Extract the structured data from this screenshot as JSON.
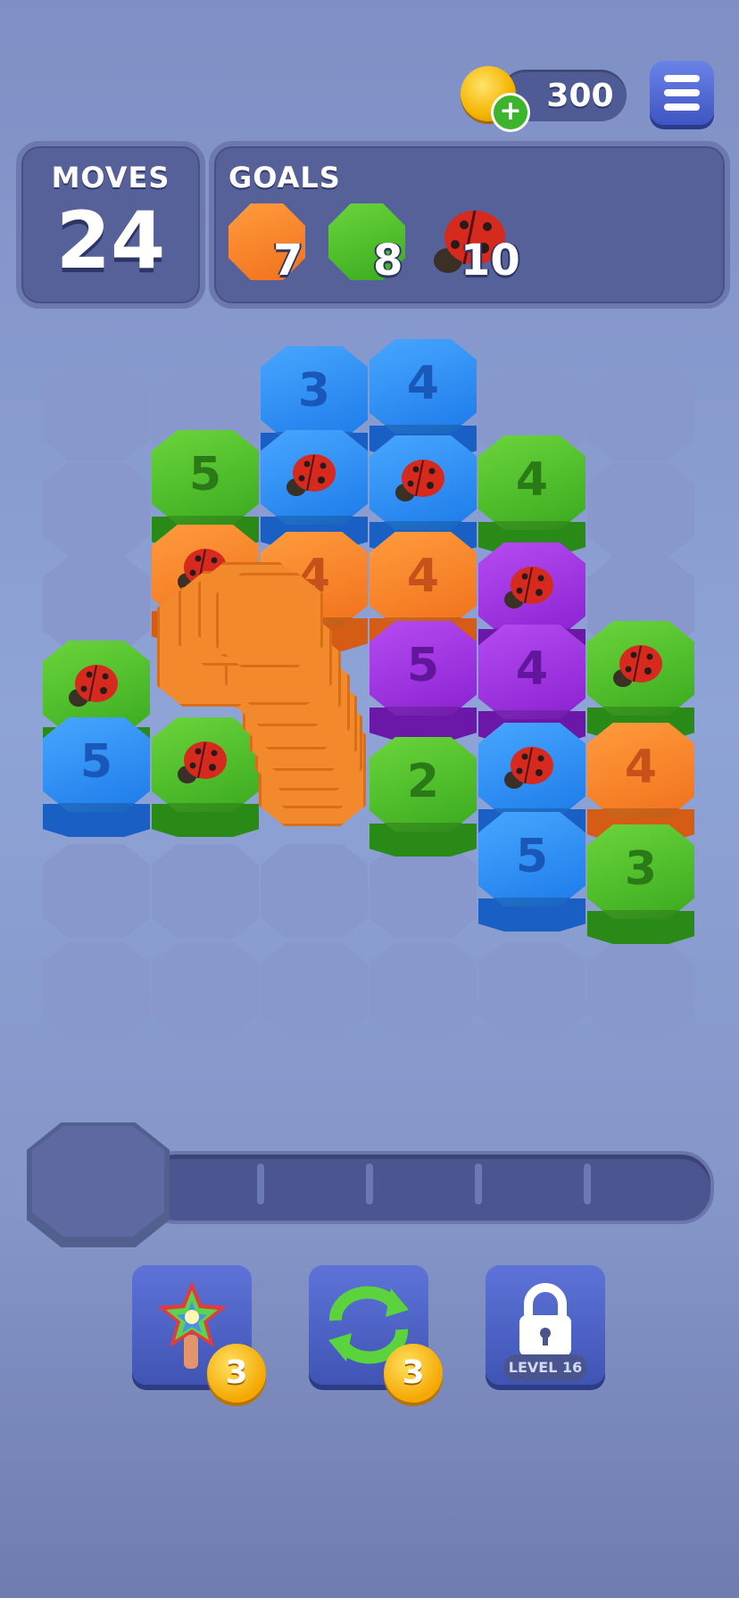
{
  "header": {
    "coins": "300",
    "coin_icon": "gold-coin-icon",
    "plus_icon": "plus-icon",
    "menu_icon": "hamburger-menu-icon"
  },
  "moves": {
    "label": "MOVES",
    "value": "24"
  },
  "goals": {
    "label": "GOALS",
    "items": [
      {
        "type": "orange-tile",
        "count": "7",
        "color": "#f58a2a"
      },
      {
        "type": "green-tile",
        "count": "8",
        "color": "#4fc22b"
      },
      {
        "type": "ladybug",
        "count": "10"
      }
    ]
  },
  "board": {
    "tiles": [
      {
        "color": "blue",
        "number": "3"
      },
      {
        "color": "blue",
        "number": "4"
      },
      {
        "color": "green",
        "number": "5"
      },
      {
        "color": "blue",
        "number": "",
        "ladybug": true
      },
      {
        "color": "blue",
        "number": "",
        "ladybug": true
      },
      {
        "color": "green",
        "number": "4"
      },
      {
        "color": "orange",
        "number": "",
        "ladybug": true
      },
      {
        "color": "orange",
        "number": "4"
      },
      {
        "color": "orange",
        "number": "4"
      },
      {
        "color": "purple",
        "number": "",
        "ladybug": true
      },
      {
        "color": "green",
        "number": "",
        "ladybug": true
      },
      {
        "color": "purple",
        "number": "5"
      },
      {
        "color": "purple",
        "number": "4"
      },
      {
        "color": "green",
        "number": "",
        "ladybug": true
      },
      {
        "color": "blue",
        "number": "5"
      },
      {
        "color": "green",
        "number": "",
        "ladybug": true
      },
      {
        "color": "green",
        "number": "2"
      },
      {
        "color": "blue",
        "number": "",
        "ladybug": true
      },
      {
        "color": "orange",
        "number": "4"
      },
      {
        "color": "blue",
        "number": "5"
      },
      {
        "color": "green",
        "number": "3"
      }
    ]
  },
  "boosters": [
    {
      "name": "rainbow-hammer",
      "icon": "rainbow-star-hammer-icon",
      "count": "3"
    },
    {
      "name": "shuffle",
      "icon": "shuffle-arrows-icon",
      "count": "3"
    },
    {
      "name": "locked",
      "icon": "padlock-icon",
      "label": "LEVEL 16"
    }
  ]
}
